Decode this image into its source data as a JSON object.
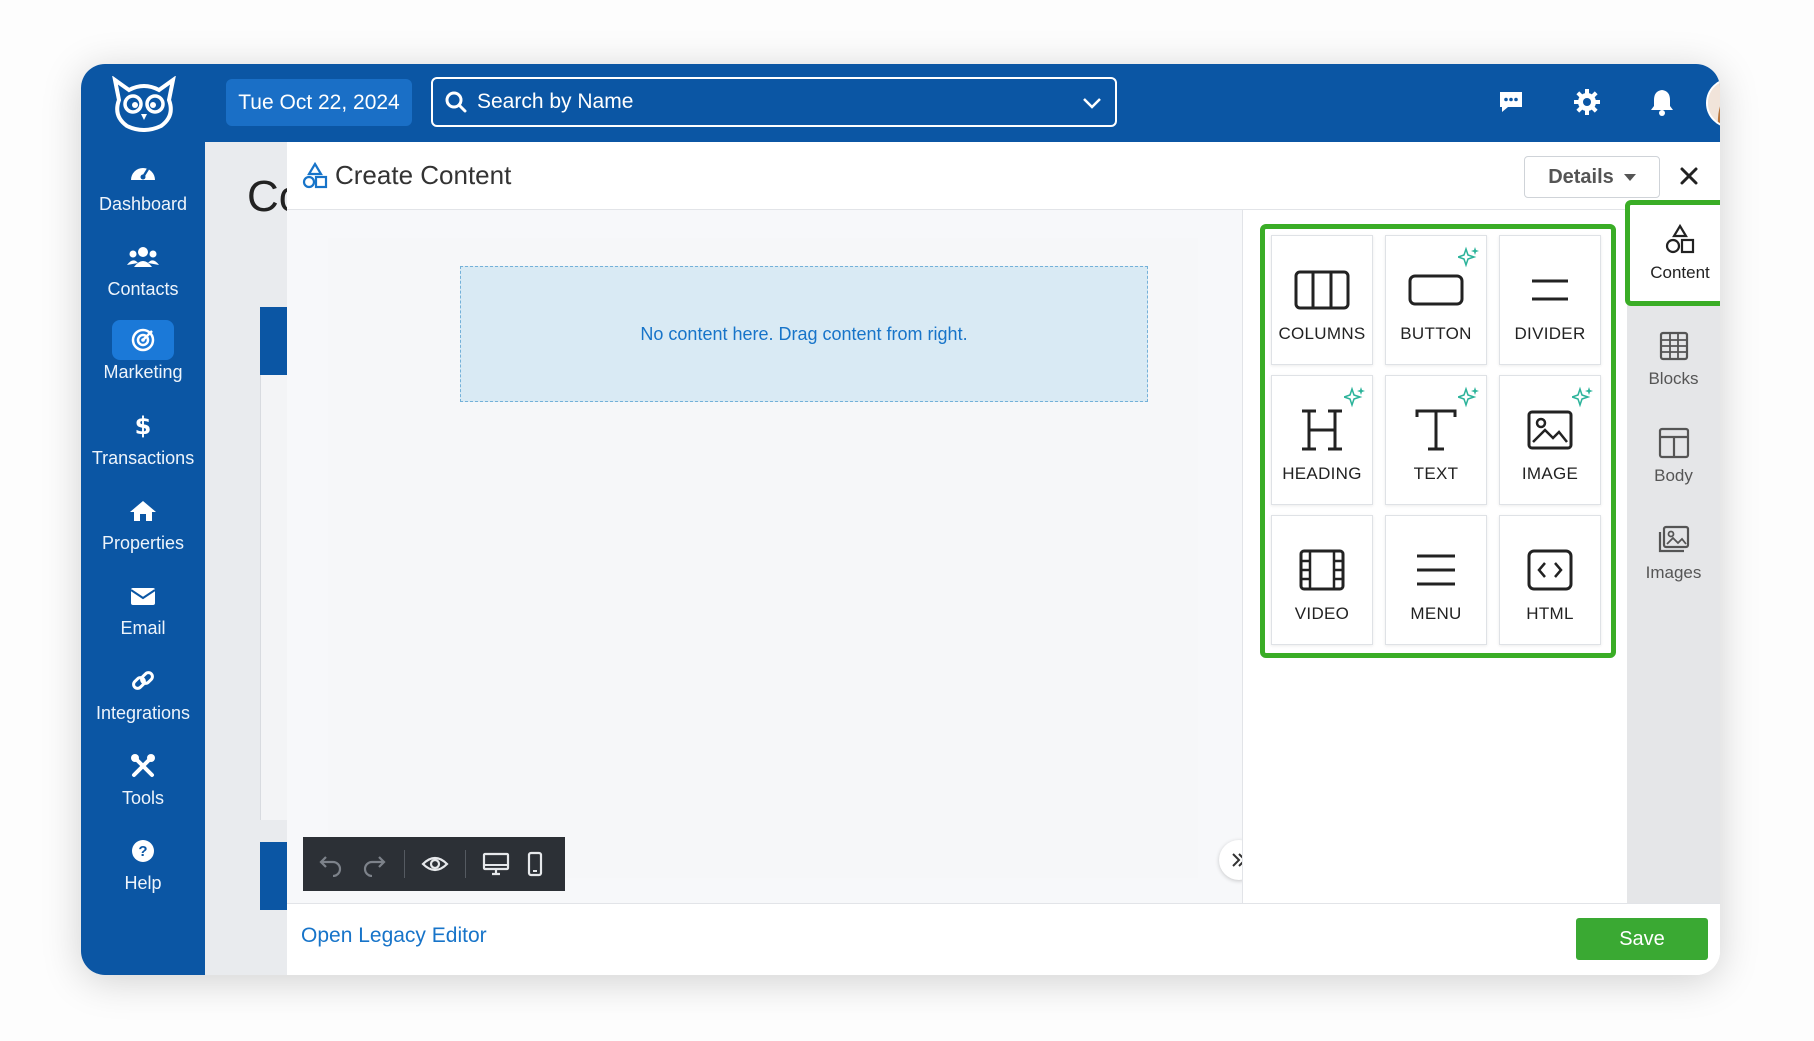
{
  "sidebar": {
    "items": [
      {
        "label": "Dashboard",
        "icon": "dashboard-gauge-icon"
      },
      {
        "label": "Contacts",
        "icon": "users-icon"
      },
      {
        "label": "Marketing",
        "icon": "target-icon",
        "active": true
      },
      {
        "label": "Transactions",
        "icon": "dollar-icon"
      },
      {
        "label": "Properties",
        "icon": "home-icon"
      },
      {
        "label": "Email",
        "icon": "envelope-icon"
      },
      {
        "label": "Integrations",
        "icon": "link-icon"
      },
      {
        "label": "Tools",
        "icon": "tools-icon"
      },
      {
        "label": "Help",
        "icon": "help-icon"
      }
    ]
  },
  "topbar": {
    "date": "Tue Oct 22, 2024",
    "search_placeholder": "Search by Name"
  },
  "background": {
    "title": "Co"
  },
  "modal": {
    "title": "Create Content",
    "details_label": "Details",
    "drop_zone_text": "No content here. Drag content from right.",
    "footer": {
      "legacy_link": "Open Legacy Editor",
      "save_label": "Save"
    }
  },
  "tools": [
    {
      "label": "COLUMNS",
      "icon": "columns-icon",
      "ai": false
    },
    {
      "label": "BUTTON",
      "icon": "button-icon",
      "ai": true
    },
    {
      "label": "DIVIDER",
      "icon": "divider-icon",
      "ai": false
    },
    {
      "label": "HEADING",
      "icon": "heading-icon",
      "ai": true
    },
    {
      "label": "TEXT",
      "icon": "text-icon",
      "ai": true
    },
    {
      "label": "IMAGE",
      "icon": "image-icon",
      "ai": true
    },
    {
      "label": "VIDEO",
      "icon": "video-icon",
      "ai": false
    },
    {
      "label": "MENU",
      "icon": "menu-icon",
      "ai": false
    },
    {
      "label": "HTML",
      "icon": "html-icon",
      "ai": false
    }
  ],
  "rail": {
    "items": [
      {
        "label": "Content",
        "icon": "shapes-icon",
        "active": true
      },
      {
        "label": "Blocks",
        "icon": "blocks-icon"
      },
      {
        "label": "Body",
        "icon": "body-layout-icon"
      },
      {
        "label": "Images",
        "icon": "images-icon"
      }
    ]
  },
  "colors": {
    "brand": "#0b56a4",
    "accent_green": "#3aad26",
    "link_blue": "#1774c9",
    "save_green": "#3aa933"
  }
}
